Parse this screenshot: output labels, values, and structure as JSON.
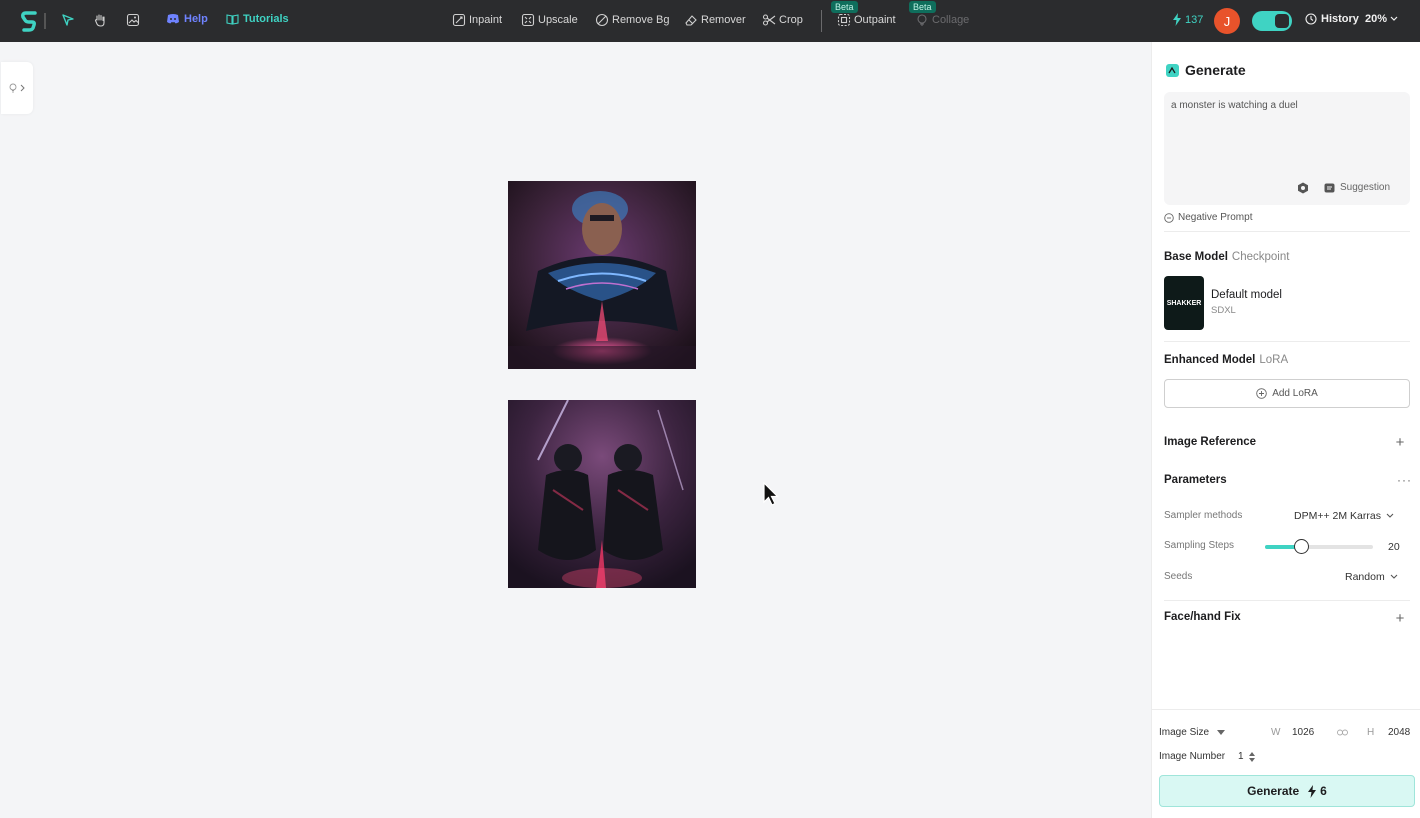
{
  "toolbar": {
    "help_label": "Help",
    "tutorials_label": "Tutorials",
    "tools": [
      {
        "label": "Inpaint"
      },
      {
        "label": "Upscale"
      },
      {
        "label": "Remove Bg"
      },
      {
        "label": "Remover"
      },
      {
        "label": "Crop"
      },
      {
        "label": "Outpaint",
        "badge": "Beta"
      },
      {
        "label": "Collage",
        "badge": "Beta"
      }
    ],
    "credits": "137",
    "avatar_initial": "J",
    "history_label": "History",
    "zoom": "20%"
  },
  "panel": {
    "title": "Generate",
    "prompt_text": "a monster is watching a duel",
    "suggestion_label": "Suggestion",
    "negative_prompt_label": "Negative Prompt",
    "base_model": {
      "title": "Base Model",
      "subtitle": "Checkpoint",
      "thumb_text": "SHAKKER",
      "name": "Default model",
      "type": "SDXL"
    },
    "enhanced_model": {
      "title": "Enhanced Model",
      "subtitle": "LoRA",
      "add_label": "Add LoRA"
    },
    "image_reference_title": "Image Reference",
    "parameters": {
      "title": "Parameters",
      "sampler_label": "Sampler methods",
      "sampler_value": "DPM++ 2M Karras",
      "steps_label": "Sampling Steps",
      "steps_value": "20",
      "seeds_label": "Seeds",
      "seeds_value": "Random"
    },
    "face_fix_title": "Face/hand Fix",
    "footer": {
      "image_size_label": "Image Size",
      "w_label": "W",
      "w_value": "1026",
      "h_label": "H",
      "h_value": "2048",
      "image_number_label": "Image Number",
      "image_number_value": "1",
      "generate_label": "Generate",
      "generate_cost": "6"
    }
  },
  "colors": {
    "accent": "#3fd3c3",
    "toolbar_bg": "#2b2c2e",
    "help_blue": "#6f83ff",
    "avatar": "#e8532b"
  }
}
